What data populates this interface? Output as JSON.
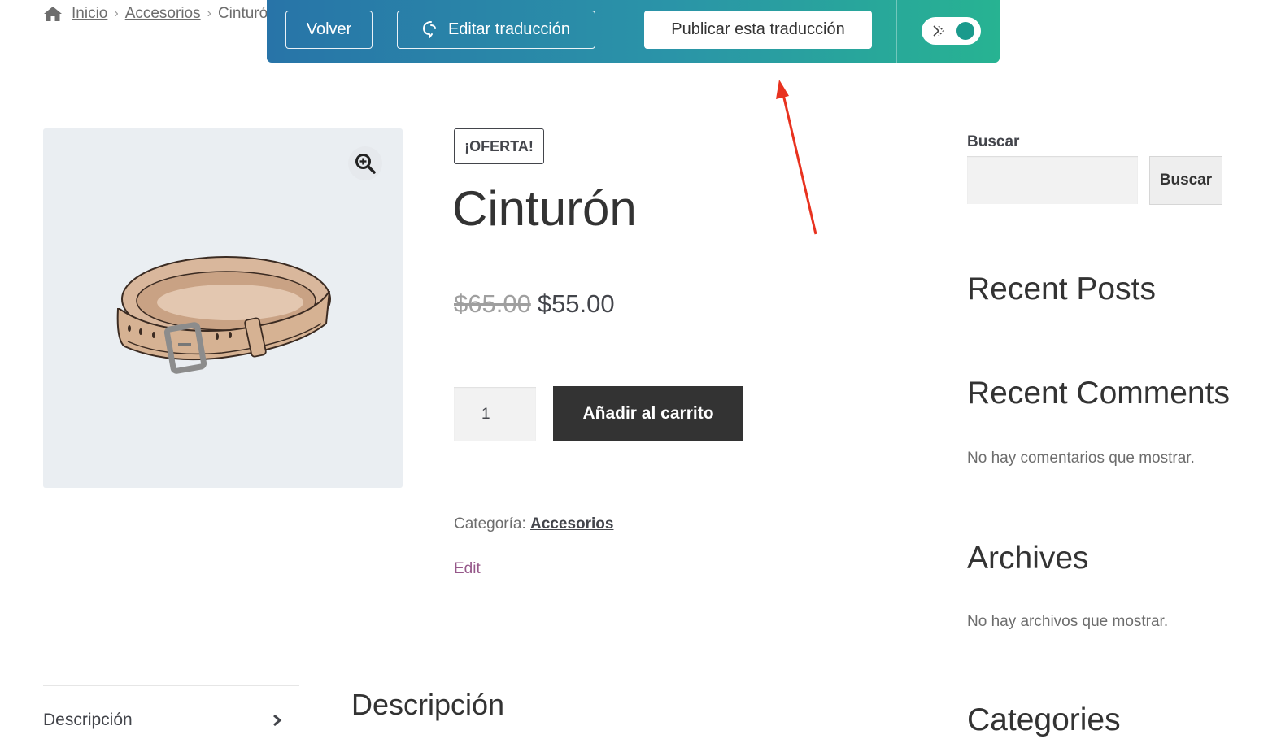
{
  "breadcrumb": {
    "items": [
      "Inicio",
      "Accesorios",
      "Cinturón"
    ],
    "separator": "›"
  },
  "translation_bar": {
    "back_label": "Volver",
    "edit_label": "Editar traducción",
    "publish_label": "Publicar esta traducción",
    "toggle_state": "on",
    "colors": {
      "gradient_start": "#2874a8",
      "gradient_end": "#27b392"
    }
  },
  "product": {
    "sale_badge": "¡OFERTA!",
    "title": "Cinturón",
    "price_old": "$65.00",
    "price_new": "$55.00",
    "quantity": "1",
    "add_to_cart_label": "Añadir al carrito",
    "category_label": "Categoría:",
    "category_value": "Accesorios",
    "edit_link": "Edit"
  },
  "tabs": {
    "items": [
      {
        "label": "Descripción"
      }
    ],
    "active_heading": "Descripción"
  },
  "sidebar": {
    "search_label": "Buscar",
    "search_button": "Buscar",
    "search_value": "",
    "widgets": [
      {
        "title": "Recent Posts",
        "text": ""
      },
      {
        "title": "Recent Comments",
        "text": "No hay comentarios que mostrar."
      },
      {
        "title": "Archives",
        "text": "No hay archivos que mostrar."
      },
      {
        "title": "Categories",
        "text": ""
      }
    ]
  },
  "colors": {
    "button_dark": "#333333",
    "edit_link": "#96588a",
    "annotation_arrow": "#e8321f"
  }
}
